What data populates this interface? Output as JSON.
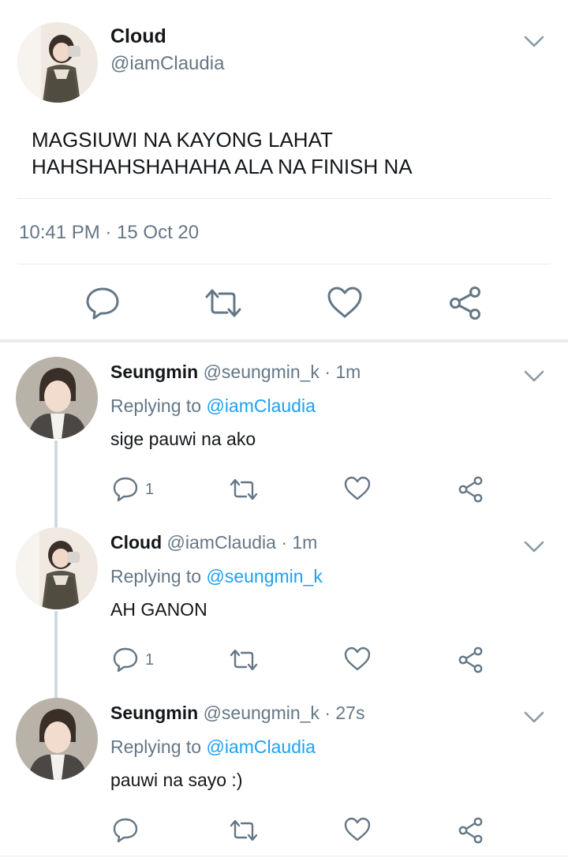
{
  "main_tweet": {
    "name": "Cloud",
    "handle": "@iamClaudia",
    "text_line1": "MAGSIUWI NA KAYONG LAHAT",
    "text_line2": "HAHSHAHSHAHAHA ALA NA FINISH NA",
    "timestamp": "10:41 PM · 15 Oct 20",
    "icons": [
      "reply-icon",
      "retweet-icon",
      "like-icon",
      "share-icon"
    ]
  },
  "replies": [
    {
      "name": "Seungmin",
      "handle": "@seungmin_k",
      "time": "· 1m",
      "replying_prefix": "Replying to ",
      "replying_to": "@iamClaudia",
      "text": "sige pauwi na ako",
      "reply_count": "1"
    },
    {
      "name": "Cloud",
      "handle": "@iamClaudia",
      "time": "· 1m",
      "replying_prefix": "Replying to ",
      "replying_to": "@seungmin_k",
      "text": "AH GANON",
      "reply_count": "1"
    },
    {
      "name": "Seungmin",
      "handle": "@seungmin_k",
      "time": "· 27s",
      "replying_prefix": "Replying to ",
      "replying_to": "@iamClaudia",
      "text": "pauwi na sayo :)",
      "reply_count": ""
    }
  ],
  "colors": {
    "text": "#14171a",
    "secondary": "#657786",
    "link": "#1da1f2",
    "divider": "#e6ecf0"
  }
}
